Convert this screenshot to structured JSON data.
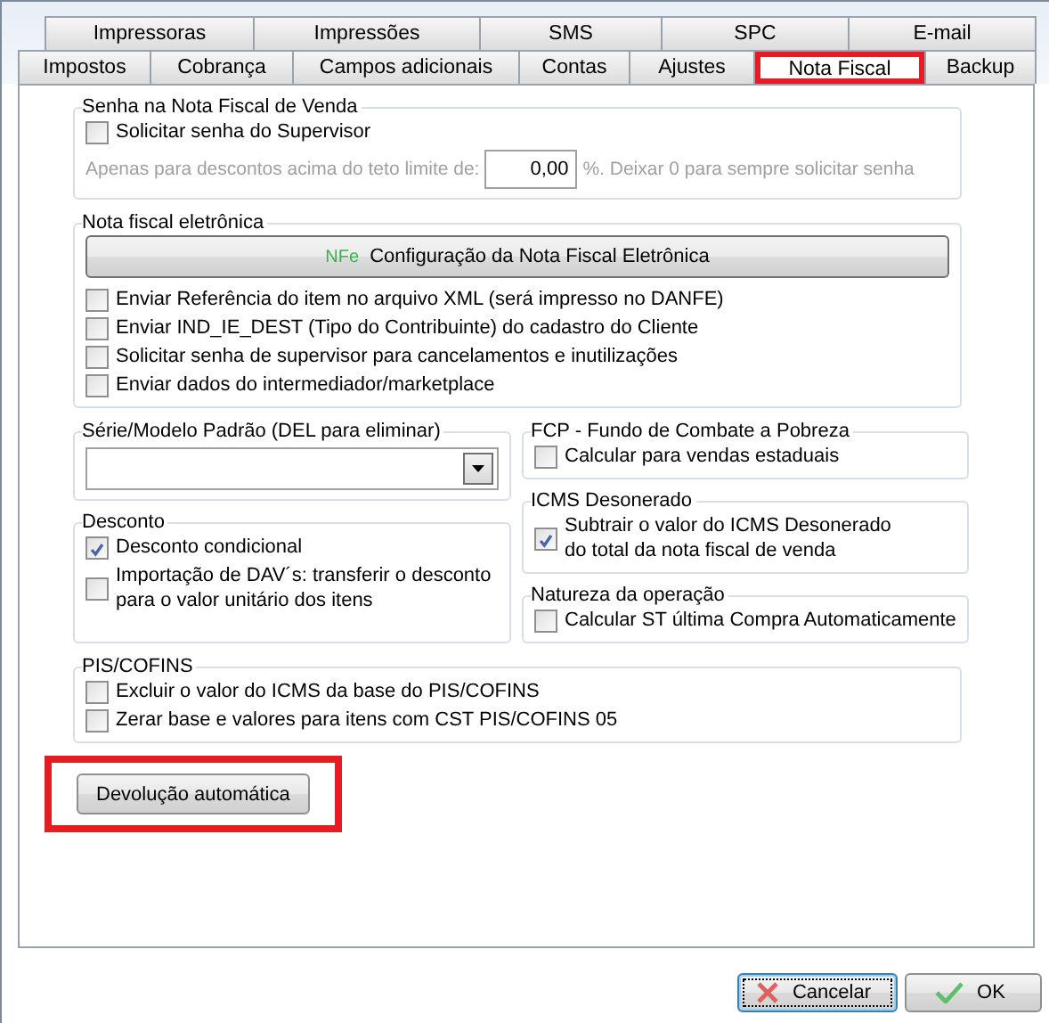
{
  "tab_rows": [
    {
      "tabs": [
        {
          "label": "Impressoras",
          "selected": false,
          "highlighted": false
        },
        {
          "label": "Impressões",
          "selected": false,
          "highlighted": false
        },
        {
          "label": "SMS",
          "selected": false,
          "highlighted": false
        },
        {
          "label": "SPC",
          "selected": false,
          "highlighted": false
        },
        {
          "label": "E-mail",
          "selected": false,
          "highlighted": false
        }
      ]
    },
    {
      "tabs": [
        {
          "label": "Impostos",
          "selected": false,
          "highlighted": false
        },
        {
          "label": "Cobrança",
          "selected": false,
          "highlighted": false
        },
        {
          "label": "Campos adicionais",
          "selected": false,
          "highlighted": false
        },
        {
          "label": "Contas",
          "selected": false,
          "highlighted": false
        },
        {
          "label": "Ajustes",
          "selected": false,
          "highlighted": false
        },
        {
          "label": "Nota Fiscal",
          "selected": true,
          "highlighted": true
        },
        {
          "label": "Backup",
          "selected": false,
          "highlighted": false
        }
      ]
    }
  ],
  "senha": {
    "title": "Senha na Nota Fiscal de Venda",
    "items": [
      {
        "kind": "checkbox",
        "label": "Solicitar senha do Supervisor",
        "checked": false
      },
      {
        "kind": "limit",
        "label": "Apenas para descontos acima do teto limite de:",
        "value": "0,00",
        "suffix": "%. Deixar 0 para sempre solicitar senha",
        "disabled": true
      }
    ]
  },
  "nfe": {
    "title": "Nota fiscal eletrônica",
    "items": [
      {
        "kind": "button",
        "badge": "NFe",
        "label": "Configuração da Nota Fiscal Eletrônica"
      },
      {
        "kind": "checkbox",
        "label": "Enviar Referência do item no arquivo XML (será impresso no DANFE)",
        "checked": false
      },
      {
        "kind": "checkbox",
        "label": "Enviar IND_IE_DEST (Tipo do Contribuinte) do cadastro do Cliente",
        "checked": false
      },
      {
        "kind": "checkbox",
        "label": "Solicitar senha de supervisor para cancelamentos e inutilizações",
        "checked": false
      },
      {
        "kind": "checkbox",
        "label": "Enviar dados do intermediador/marketplace",
        "checked": false
      }
    ]
  },
  "left_column": [
    {
      "title": "Série/Modelo Padrão (DEL para eliminar)",
      "items": [
        {
          "kind": "dropdown"
        }
      ]
    },
    {
      "title": "Desconto",
      "items": [
        {
          "kind": "checkbox",
          "label": "Desconto condicional",
          "checked": true
        },
        {
          "kind": "checkbox",
          "label": "Importação de DAV´s: transferir o desconto\npara o valor unitário dos itens",
          "checked": false
        }
      ]
    }
  ],
  "right_column": [
    {
      "title": "FCP - Fundo de Combate a Pobreza",
      "items": [
        {
          "kind": "checkbox",
          "label": "Calcular para vendas estaduais",
          "checked": false
        }
      ]
    },
    {
      "title": "ICMS Desonerado",
      "items": [
        {
          "kind": "checkbox",
          "label": "Subtrair o valor do ICMS Desonerado\ndo total da nota fiscal de venda",
          "checked": true
        }
      ]
    },
    {
      "title": "Natureza da operação",
      "items": [
        {
          "kind": "checkbox",
          "label": "Calcular ST última Compra Automaticamente",
          "checked": false
        }
      ]
    }
  ],
  "pis": {
    "title": "PIS/COFINS",
    "items": [
      {
        "kind": "checkbox",
        "label": "Excluir o valor do ICMS da base do PIS/COFINS",
        "checked": false
      },
      {
        "kind": "checkbox",
        "label": "Zerar base e valores para itens com CST PIS/COFINS 05",
        "checked": false
      }
    ]
  },
  "devolucao_button": {
    "label": "Devolução automática",
    "highlighted": true
  },
  "buttons": [
    {
      "kind": "cancel",
      "label": "Cancelar",
      "focused": true
    },
    {
      "kind": "ok",
      "label": "OK",
      "focused": false
    }
  ]
}
